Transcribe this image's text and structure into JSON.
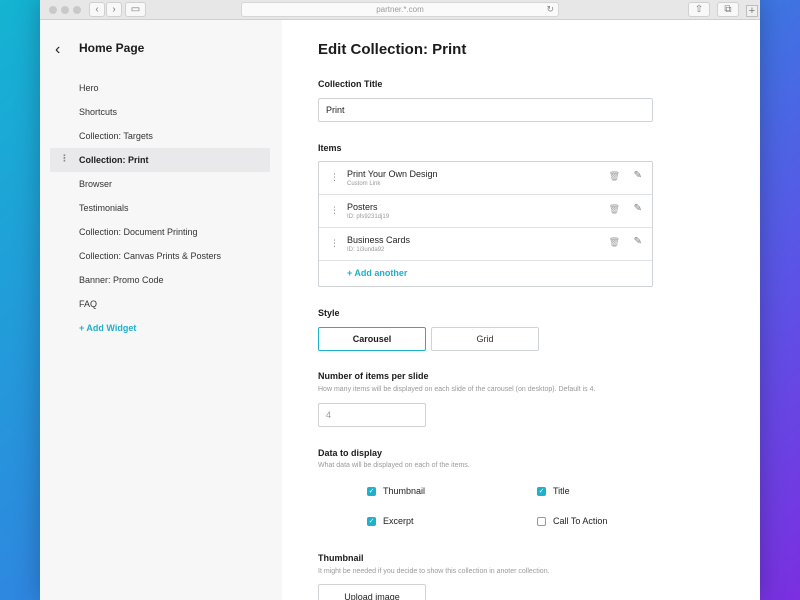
{
  "browser": {
    "url": "partner.*.com",
    "reload_icon": "↻",
    "back_icon": "‹",
    "forward_icon": "›",
    "sidebar_icon": "▭",
    "share_icon": "⇧",
    "tabs_icon": "⧉",
    "newtab_icon": "+"
  },
  "sidebar": {
    "back_icon": "‹",
    "title": "Home Page",
    "drag_icon": "⋮",
    "items": [
      {
        "label": "Hero"
      },
      {
        "label": "Shortcuts"
      },
      {
        "label": "Collection: Targets"
      },
      {
        "label": "Collection: Print",
        "active": true
      },
      {
        "label": "Browser"
      },
      {
        "label": "Testimonials"
      },
      {
        "label": "Collection: Document Printing"
      },
      {
        "label": "Collection: Canvas Prints & Posters"
      },
      {
        "label": "Banner: Promo Code"
      },
      {
        "label": "FAQ"
      }
    ],
    "add_widget": "+ Add Widget"
  },
  "main": {
    "heading": "Edit Collection: Print",
    "collection_title": {
      "label": "Collection Title",
      "value": "Print"
    },
    "items": {
      "label": "Items",
      "drag_icon": "⋮",
      "trash_icon": "🗑",
      "edit_icon": "✎",
      "rows": [
        {
          "title": "Print Your Own Design",
          "subtitle": "Custom Link"
        },
        {
          "title": "Posters",
          "subtitle": "ID: pfs9231dj19"
        },
        {
          "title": "Business Cards",
          "subtitle": "ID: 1i3unda92"
        }
      ],
      "add_another": "+ Add another"
    },
    "style": {
      "label": "Style",
      "options": [
        "Carousel",
        "Grid"
      ],
      "selected": "Carousel"
    },
    "items_per_slide": {
      "label": "Number of items per slide",
      "help": "How many items will be displayed on each slide of the carousel (on desktop). Default is 4.",
      "placeholder": "4"
    },
    "data_to_display": {
      "label": "Data to display",
      "help": "What data will be displayed on each of the items.",
      "check_icon": "✓",
      "options": [
        {
          "label": "Thumbnail",
          "checked": true
        },
        {
          "label": "Title",
          "checked": true
        },
        {
          "label": "Excerpt",
          "checked": true
        },
        {
          "label": "Call To Action",
          "checked": false
        }
      ]
    },
    "thumbnail": {
      "label": "Thumbnail",
      "help": "It might be needed if you decide to show this collection in anoter collection.",
      "upload_label": "Upload image"
    }
  },
  "colors": {
    "accent": "#1fb1cc",
    "sidebar_bg": "#f7f7f8",
    "active_item_bg": "#e9e9eb"
  }
}
